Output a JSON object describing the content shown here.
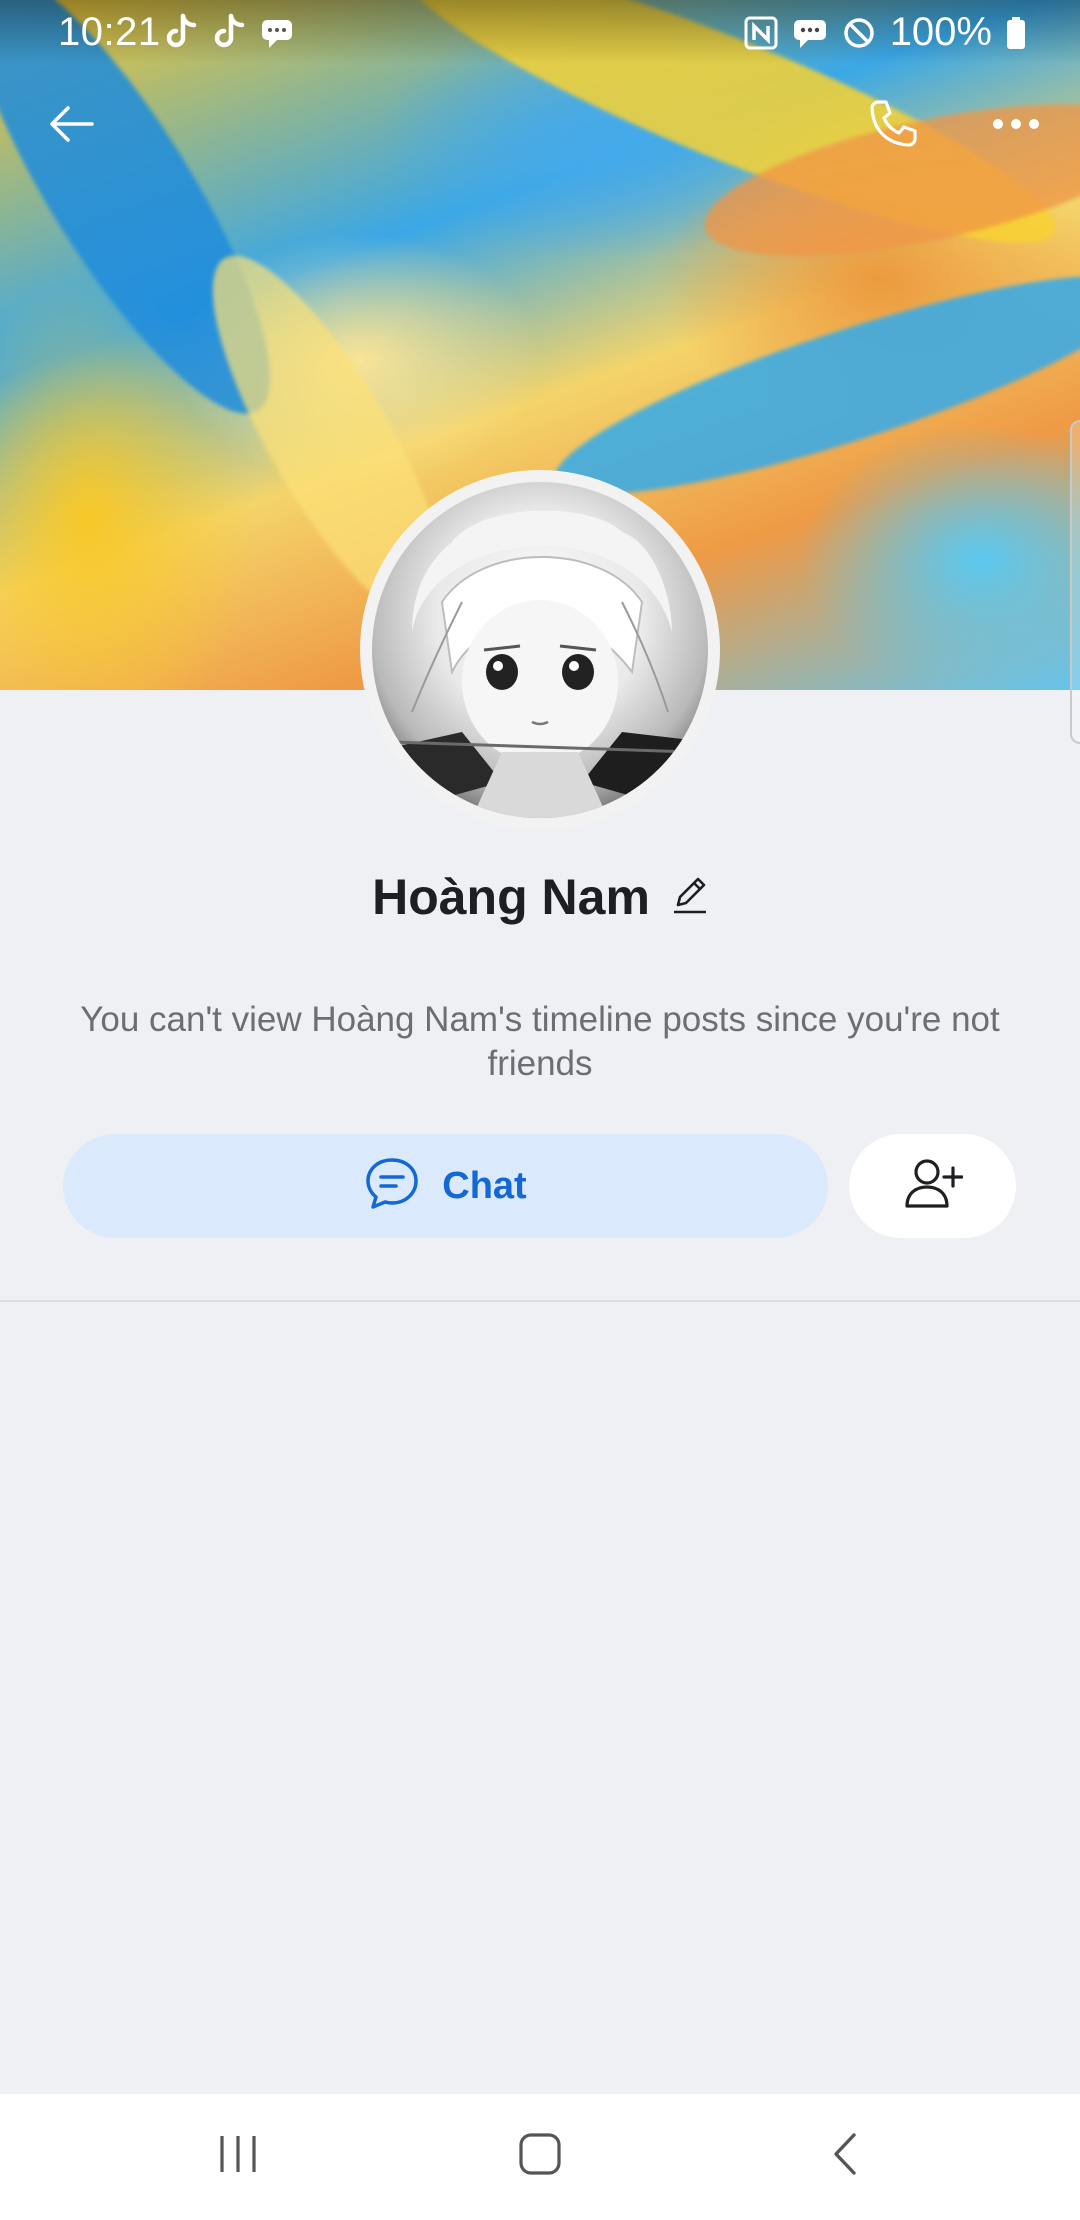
{
  "status_bar": {
    "time": "10:21",
    "battery": "100%",
    "left_icons": [
      "tiktok-icon",
      "tiktok-icon",
      "chat-notification-icon"
    ],
    "right_icons": [
      "nfc-icon",
      "message-icon",
      "do-not-disturb-icon",
      "battery-icon"
    ]
  },
  "header": {
    "back_icon": "arrow-left-icon",
    "call_icon": "phone-icon",
    "more_icon": "more-horizontal-icon"
  },
  "profile": {
    "name": "Hoàng Nam",
    "edit_icon": "pencil-icon",
    "notice": "You can't view Hoàng Nam's timeline posts since you're not friends"
  },
  "actions": {
    "chat_label": "Chat",
    "chat_icon": "chat-bubble-icon",
    "add_friend_icon": "add-friend-icon"
  },
  "nav_bar": {
    "recent_icon": "recent-apps-icon",
    "home_icon": "home-icon",
    "back_icon": "back-icon"
  },
  "colors": {
    "background": "#eff0f4",
    "chat_button_bg": "#dbe9fd",
    "chat_accent": "#1468d6",
    "name_text": "#1d1f23",
    "notice_text": "#6b6f75"
  }
}
